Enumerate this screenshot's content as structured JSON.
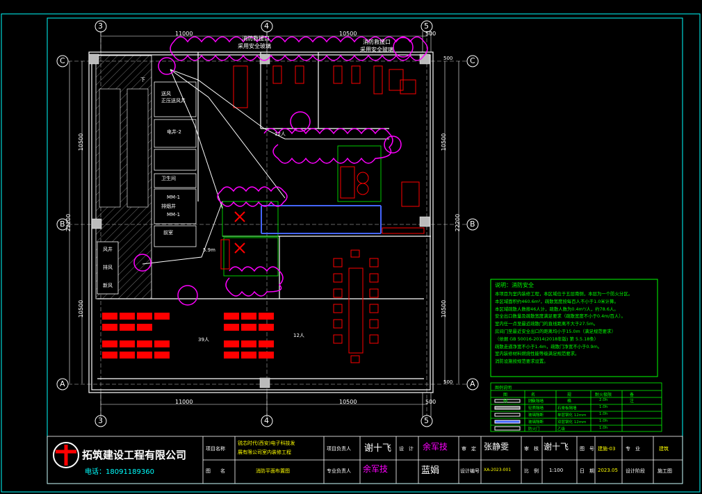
{
  "grid": {
    "cols": [
      "3",
      "4",
      "5"
    ],
    "rows": [
      "C",
      "B",
      "A"
    ],
    "dims_top": [
      "11000",
      "10500",
      "500"
    ],
    "dims_bottom": [
      "11000",
      "10500",
      "500"
    ],
    "dims_left": [
      "10500",
      "22200",
      "10500"
    ],
    "dims_right": [
      "10500",
      "22200",
      "10500"
    ],
    "dims_right_small": [
      "500",
      "500"
    ]
  },
  "plan": {
    "fire_window_1": "消防救援口",
    "fire_window_1b": "采用安全玻璃",
    "fire_window_2": "消防救援口",
    "fire_window_2b": "采用安全玻璃",
    "shaft": "送风\n正压送风井",
    "pipe_well": "电井-2",
    "pipe_well2": "管道井",
    "restroom": "卫生间",
    "mm1": "MM-1",
    "mm2": "MM-1",
    "shaft2": "排烟井",
    "front": "前室",
    "side1": "风井",
    "side2": "排风",
    "side3": "新风",
    "occupancy_1": "12人",
    "occupancy_2": "39人",
    "occupancy_3": "12人",
    "dist": "5.9m",
    "note_arrow": "下"
  },
  "notes": {
    "title": "说明：消防安全",
    "lines": [
      "本项目为室内装修工程，本区域位于五层南侧，本层为一个防火分区。",
      "本区域面积约460.6m²，疏散宽度按每百人不小于1.0米计算。",
      "本区域疏散人数按46人计，疏散人数为0.4m²/人，约78.6人。",
      "安全出口数量及疏散宽度满足要求（疏散宽度不小于0.4m/百人）。",
      "室内任一点至最近疏散门的直线距离不大于27.5m。",
      "房间门至最近安全出口的距离均小于15.0m（满足规范要求）",
      "（依据 GB 50016-2014(2018年版) 第 5.5.18条）",
      "疏散走道净宽不小于1.4m，疏散门净宽不小于0.9m。",
      "室内装修材料燃烧性能等级满足规范要求。",
      "消防设施按规范要求设置。"
    ]
  },
  "legend": {
    "title": "图例说明",
    "headers": [
      "图例",
      "名称",
      "规格",
      "耐火极限",
      "备注"
    ],
    "rows": [
      [
        "",
        "防火隔墙",
        "",
        "2.0h",
        ""
      ],
      [
        "",
        "轻质隔墙",
        "石膏板隔墙",
        "1.0h",
        ""
      ],
      [
        "",
        "玻璃隔断",
        "单层钢化 12mm",
        "1.0h",
        ""
      ],
      [
        "",
        "玻璃隔断",
        "双层钢化 12mm",
        "1.0h",
        ""
      ],
      [
        "",
        "防火门",
        "乙级",
        "1.0h",
        ""
      ]
    ]
  },
  "titleblock": {
    "company": "拓筑建设工程有限公司",
    "phone": "电话：18091189360",
    "project_label": "项目名称",
    "project_name_1": "锐芯时代(西安)电子科技发",
    "project_name_2": "展有限公司室内装修工程",
    "drawing_label": "图　　名",
    "drawing_name": "消防平面布置图",
    "owner_label": "项目负责人",
    "owner_sig": "谢十飞",
    "design_label": "设　计",
    "design_sig": "余军技",
    "review_label": "审　定",
    "review_sig": "张静雯",
    "audit_label": "审　核",
    "audit_sig": "谢十飞",
    "fig_label": "图　号",
    "fig_no": "建施-03",
    "spec_label": "专　业",
    "spec_val": "建筑",
    "pro_label": "专业负责人",
    "pro_sig": "余军技",
    "check_sig": "蓝娟",
    "code_label": "设计编号",
    "code_val": "XA-2023-001",
    "scale_label": "比　例",
    "scale_val": "1:100",
    "date_label": "日　期",
    "date_val": "2023.05",
    "phase_label": "设计阶段",
    "phase_val": "施工图"
  },
  "colors": {
    "bg": "#000000",
    "border": "#00ffff",
    "wall": "#ffffff",
    "cloud": "#ff00ff",
    "green": "#00ff00",
    "red": "#ff0000",
    "yellow": "#ffff00",
    "grey": "#808080"
  }
}
